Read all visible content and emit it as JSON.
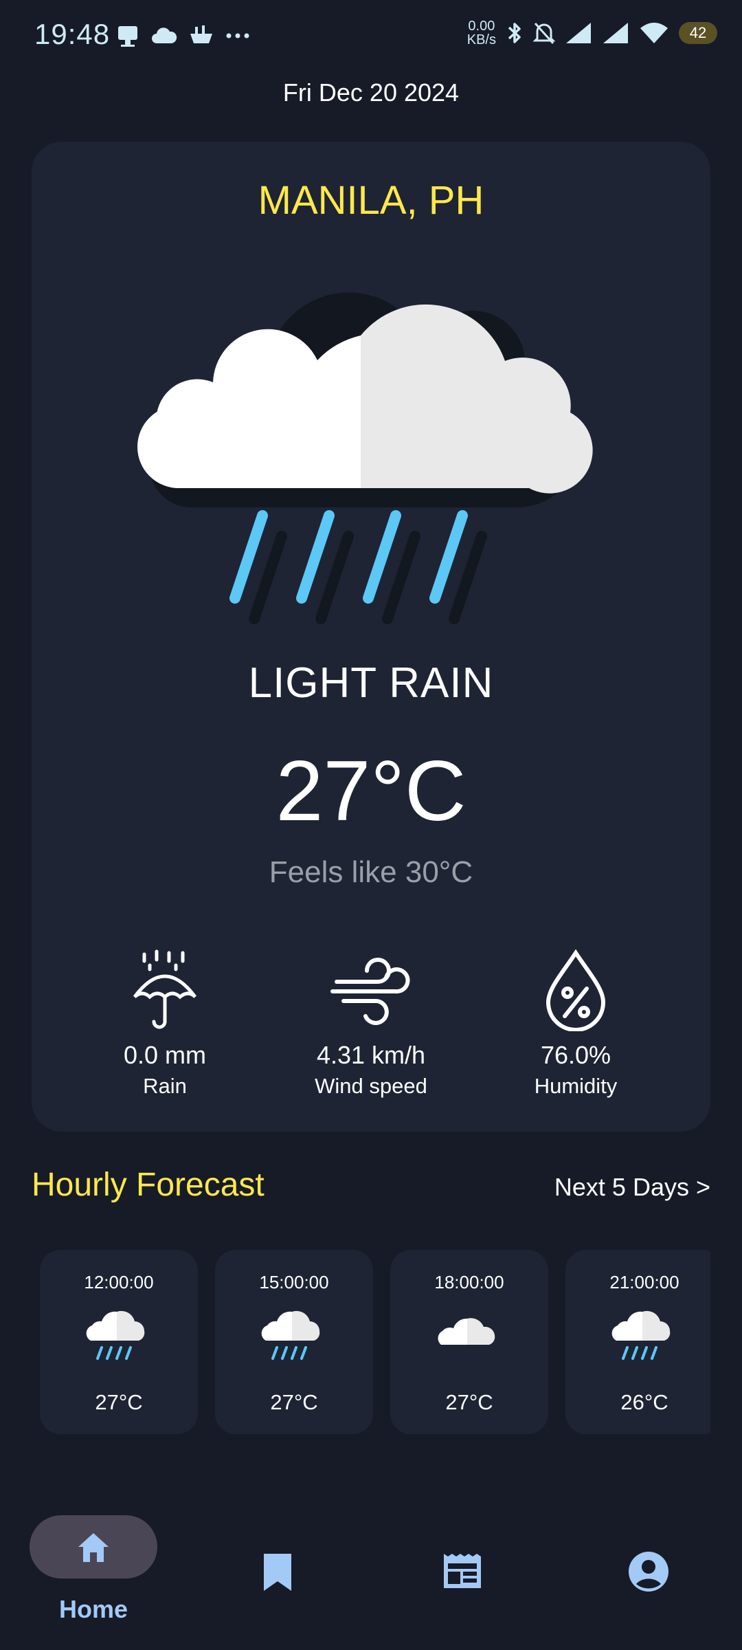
{
  "status_bar": {
    "time": "19:48",
    "net_speed_value": "0.00",
    "net_speed_unit": "KB/s",
    "battery": "42",
    "left_icons": [
      "notification-icon",
      "cloud-icon",
      "boat-icon",
      "more-icon"
    ],
    "right_icons": [
      "bluetooth-icon",
      "mute-icon",
      "signal-icon",
      "signal-icon",
      "wifi-icon"
    ]
  },
  "date": "Fri Dec 20 2024",
  "current": {
    "city": "MANILA, PH",
    "condition": "LIGHT RAIN",
    "temperature": "27°C",
    "feels_like": "Feels like 30°C",
    "icon": "light-rain-icon"
  },
  "stats": [
    {
      "value": "0.0 mm",
      "label": "Rain",
      "icon": "umbrella-rain-icon"
    },
    {
      "value": "4.31 km/h",
      "label": "Wind speed",
      "icon": "wind-icon"
    },
    {
      "value": "76.0%",
      "label": "Humidity",
      "icon": "humidity-drop-icon"
    }
  ],
  "hourly": {
    "title": "Hourly Forecast",
    "next_link": "Next 5 Days >",
    "items": [
      {
        "time": "12:00:00",
        "temp": "27°C",
        "icon": "rain-cloud-icon"
      },
      {
        "time": "15:00:00",
        "temp": "27°C",
        "icon": "rain-cloud-icon"
      },
      {
        "time": "18:00:00",
        "temp": "27°C",
        "icon": "cloud-icon"
      },
      {
        "time": "21:00:00",
        "temp": "26°C",
        "icon": "rain-cloud-icon"
      }
    ]
  },
  "nav": {
    "home_label": "Home",
    "items": [
      "home-icon",
      "bookmark-icon",
      "news-icon",
      "account-icon"
    ]
  },
  "colors": {
    "background": "#171b27",
    "card": "#1e2434",
    "accent_yellow": "#ffe94a",
    "rain_blue": "#5bc8f5",
    "nav_accent": "#a3c9f7"
  }
}
